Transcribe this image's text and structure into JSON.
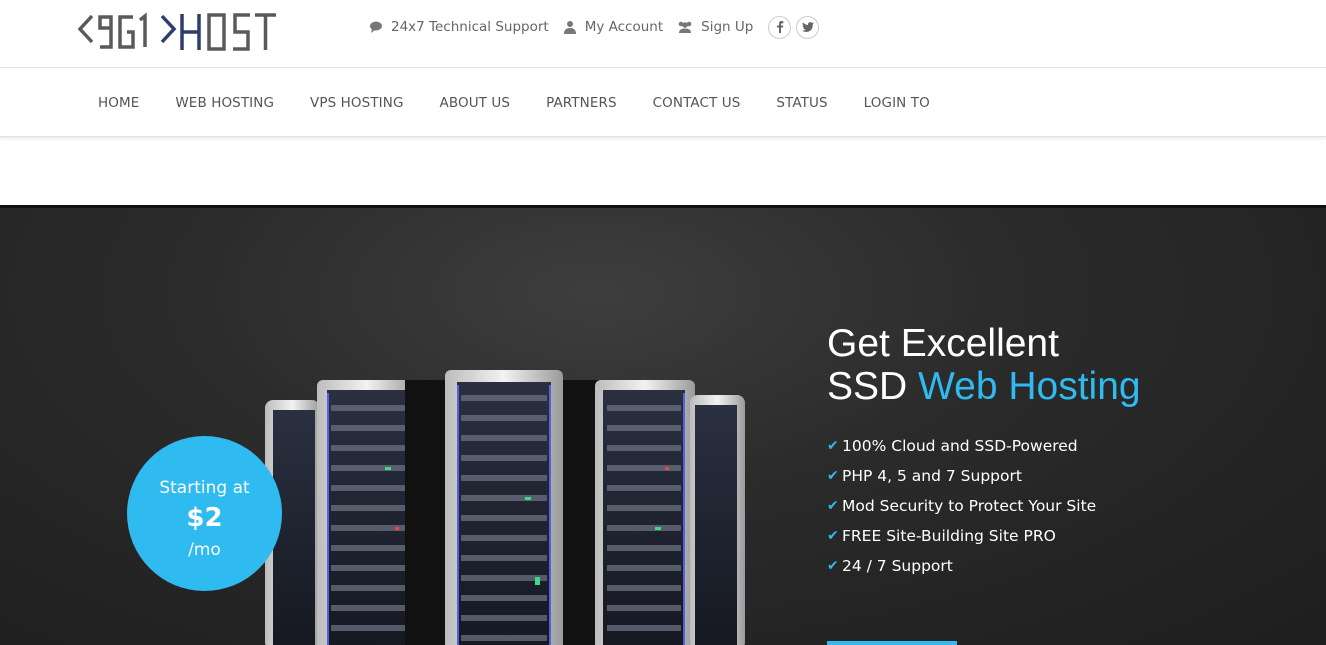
{
  "brand": {
    "logo_text": "<9G1>HOST",
    "accent_color": "#2fbaf0",
    "logo_dark": "#5a5a5a",
    "logo_blue": "#2d3e6b"
  },
  "topbar": {
    "links": [
      {
        "icon": "chat-bubble-icon",
        "label": "24x7 Technical Support"
      },
      {
        "icon": "user-icon",
        "label": "My Account"
      },
      {
        "icon": "users-icon",
        "label": "Sign Up"
      }
    ],
    "social": [
      {
        "icon": "facebook-icon",
        "glyph": "f"
      },
      {
        "icon": "twitter-icon",
        "glyph": "t"
      }
    ]
  },
  "nav": {
    "items": [
      "HOME",
      "WEB HOSTING",
      "VPS HOSTING",
      "ABOUT US",
      "PARTNERS",
      "CONTACT US",
      "STATUS",
      "LOGIN TO"
    ]
  },
  "hero": {
    "badge": {
      "line1": "Starting at",
      "price": "$2",
      "period": "/mo"
    },
    "headline_line1": "Get Excellent",
    "headline_line2_plain": "SSD ",
    "headline_line2_accent": "Web Hosting",
    "features": [
      "100% Cloud and SSD-Powered",
      "PHP 4, 5 and 7 Support",
      "Mod Security to Protect Your Site",
      "FREE Site-Building Site PRO",
      "24 / 7 Support"
    ],
    "check_glyph": "✔"
  }
}
